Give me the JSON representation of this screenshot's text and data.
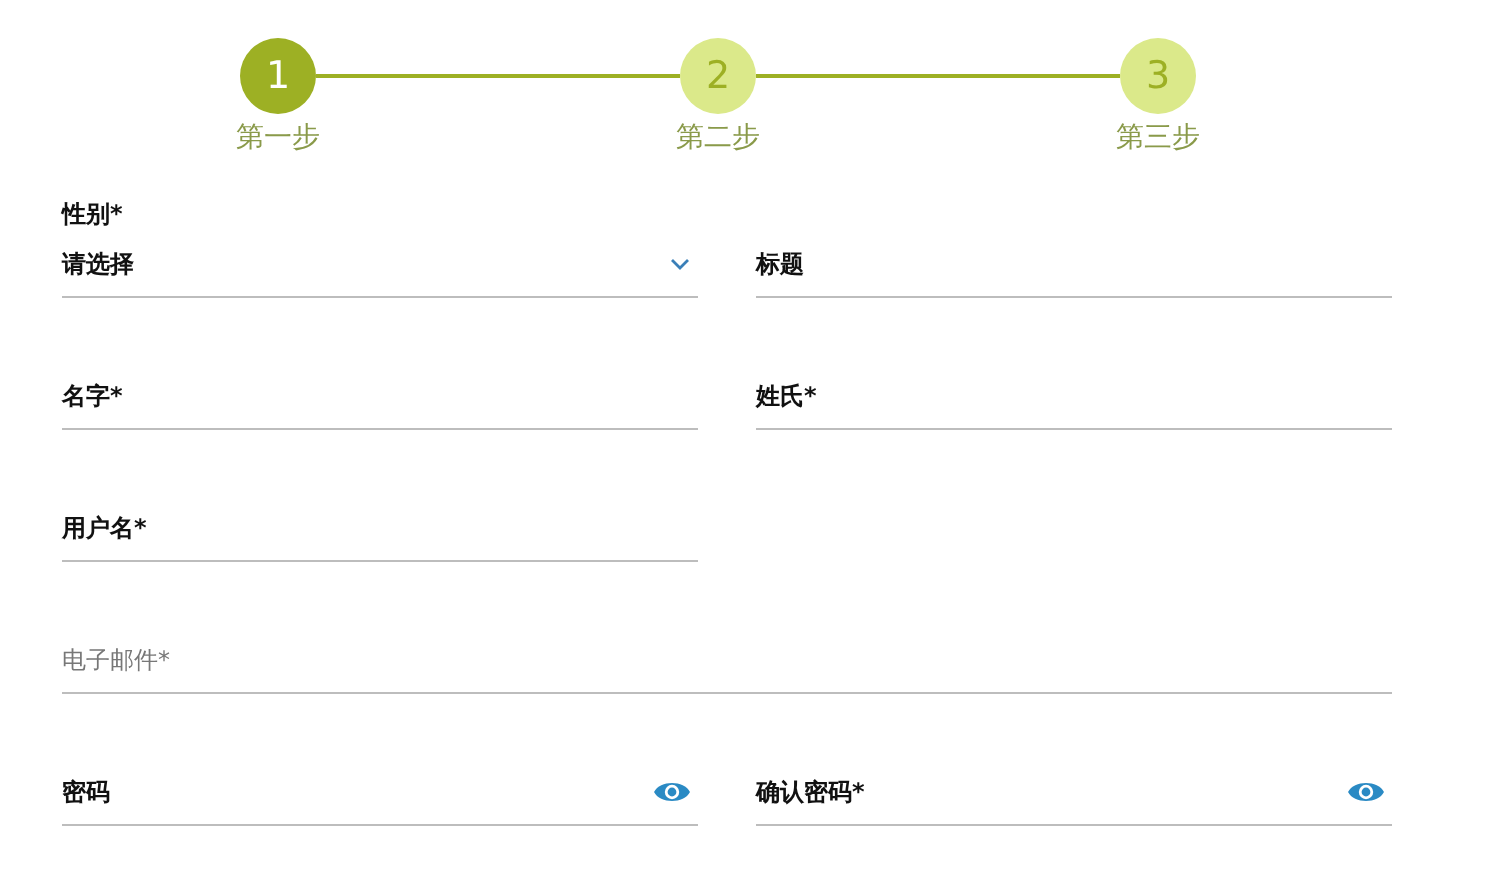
{
  "stepper": [
    {
      "number": "1",
      "label": "第一步",
      "selected": true
    },
    {
      "number": "2",
      "label": "第二步",
      "selected": false
    },
    {
      "number": "3",
      "label": "第三步",
      "selected": false
    }
  ],
  "form": {
    "rows": [
      [
        {
          "kind": "select",
          "label": "性别*",
          "value": "请选择"
        },
        {
          "kind": "text",
          "label": "标题"
        }
      ],
      [
        {
          "kind": "text",
          "label": "名字*"
        },
        {
          "kind": "text",
          "label": "姓氏*"
        }
      ],
      [
        {
          "kind": "text",
          "label": "用户名*"
        }
      ],
      [
        {
          "kind": "wide",
          "placeholder": "电子邮件*"
        }
      ],
      [
        {
          "kind": "password",
          "label": "密码"
        },
        {
          "kind": "password",
          "label": "确认密码*"
        }
      ]
    ]
  }
}
